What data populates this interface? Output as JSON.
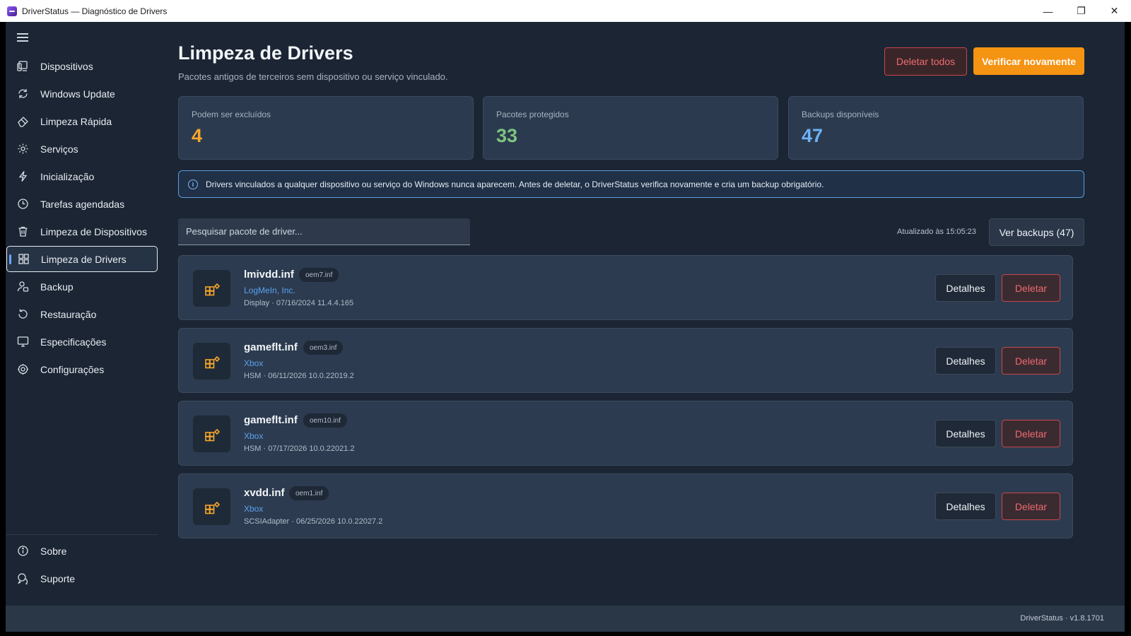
{
  "window": {
    "title": "DriverStatus — Diagnóstico de Drivers",
    "controls": [
      "—",
      "❐",
      "✕"
    ]
  },
  "sidebar": {
    "items": [
      {
        "label": "Dispositivos",
        "icon": "devices-icon"
      },
      {
        "label": "Windows Update",
        "icon": "refresh-icon"
      },
      {
        "label": "Limpeza Rápida",
        "icon": "eraser-icon"
      },
      {
        "label": "Serviços",
        "icon": "gear-icon"
      },
      {
        "label": "Inicialização",
        "icon": "bolt-icon"
      },
      {
        "label": "Tarefas agendadas",
        "icon": "clock-icon"
      },
      {
        "label": "Limpeza de Dispositivos",
        "icon": "trash-icon"
      },
      {
        "label": "Limpeza de Drivers",
        "icon": "grid-icon",
        "active": true
      },
      {
        "label": "Backup",
        "icon": "backup-icon"
      },
      {
        "label": "Restauração",
        "icon": "restore-icon"
      },
      {
        "label": "Especificações",
        "icon": "monitor-icon"
      },
      {
        "label": "Configurações",
        "icon": "settings-icon"
      }
    ],
    "bottom": [
      {
        "label": "Sobre",
        "icon": "info-icon"
      },
      {
        "label": "Suporte",
        "icon": "support-icon"
      }
    ]
  },
  "header": {
    "title": "Limpeza de Drivers",
    "subtitle": "Pacotes antigos de terceiros sem dispositivo ou serviço vinculado.",
    "delete_all_label": "Deletar todos",
    "verify_label": "Verificar novamente"
  },
  "stats": [
    {
      "label": "Podem ser excluídos",
      "value": "4",
      "color": "#f5a62a"
    },
    {
      "label": "Pacotes protegidos",
      "value": "33",
      "color": "#7cc47f"
    },
    {
      "label": "Backups disponíveis",
      "value": "47",
      "color": "#6eb1f5"
    }
  ],
  "info_banner": "Drivers vinculados a qualquer dispositivo ou serviço do Windows nunca aparecem. Antes de deletar, o DriverStatus verifica novamente e cria um backup obrigatório.",
  "search": {
    "placeholder": "Pesquisar pacote de driver..."
  },
  "updated_text": "Atualizado às 15:05:23",
  "view_backups_label": "Ver backups (47)",
  "drivers": [
    {
      "name": "lmivdd.inf",
      "oem": "oem7.inf",
      "vendor": "LogMeIn, Inc.",
      "meta": "Display  ·  07/16/2024 11.4.4.165"
    },
    {
      "name": "gameflt.inf",
      "oem": "oem3.inf",
      "vendor": "Xbox",
      "meta": "HSM  ·  06/11/2026 10.0.22019.2"
    },
    {
      "name": "gameflt.inf",
      "oem": "oem10.inf",
      "vendor": "Xbox",
      "meta": "HSM  ·  07/17/2026 10.0.22021.2"
    },
    {
      "name": "xvdd.inf",
      "oem": "oem1.inf",
      "vendor": "Xbox",
      "meta": "SCSIAdapter  ·  06/25/2026 10.0.22027.2"
    }
  ],
  "card_buttons": {
    "details": "Detalhes",
    "delete": "Deletar"
  },
  "footer": {
    "version": "DriverStatus · v1.8.1701"
  },
  "colors": {
    "accent": "#f59312",
    "danger": "#c9444a",
    "link": "#5aa3f0",
    "background": "#1b2533"
  }
}
